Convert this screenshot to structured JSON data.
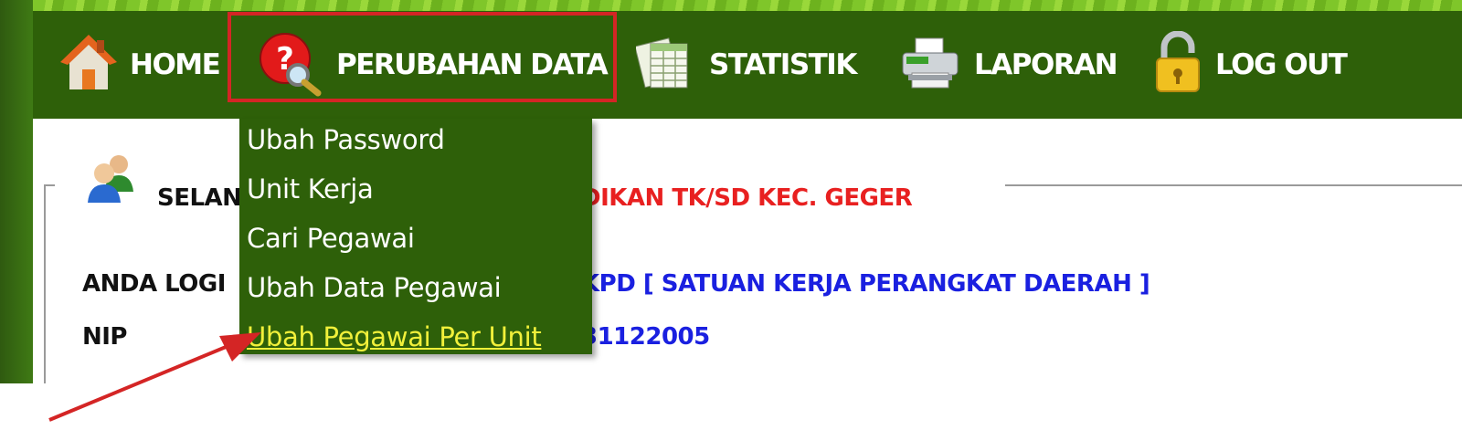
{
  "nav": {
    "items": [
      {
        "id": "home",
        "label": "HOME",
        "icon": "house-icon"
      },
      {
        "id": "perubahan",
        "label": "PERUBAHAN DATA",
        "icon": "question-magnifier-icon"
      },
      {
        "id": "statistik",
        "label": "STATISTIK",
        "icon": "spreadsheet-icon"
      },
      {
        "id": "laporan",
        "label": "LAPORAN",
        "icon": "printer-icon"
      },
      {
        "id": "logout",
        "label": "LOG OUT",
        "icon": "padlock-icon"
      }
    ]
  },
  "dropdown": {
    "items": [
      {
        "label": "Ubah Password"
      },
      {
        "label": "Unit Kerja"
      },
      {
        "label": "Cari Pegawai"
      },
      {
        "label": "Ubah Data Pegawai"
      },
      {
        "label": "Ubah Pegawai Per Unit",
        "active": true
      }
    ]
  },
  "content": {
    "welcome_label": "SELAN",
    "welcome_value": "DIKAN TK/SD KEC. GEGER",
    "rows": [
      {
        "label": "ANDA LOGI",
        "value": "KPD [ SATUAN KERJA PERANGKAT DAERAH ]"
      },
      {
        "label": "NIP",
        "value": "31122005"
      }
    ]
  },
  "colors": {
    "nav_bg": "#2e6009",
    "highlight": "#d42525",
    "arrow": "#d42525",
    "active_item": "#f1f03a",
    "value_blue": "#1a20e0",
    "value_red": "#e82020"
  }
}
